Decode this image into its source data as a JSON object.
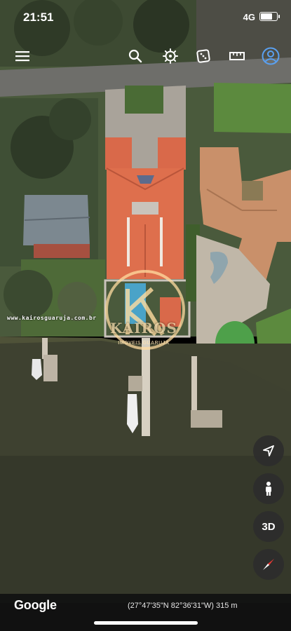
{
  "status_bar": {
    "time": "21:51",
    "network": "4G",
    "battery_level": 0.8
  },
  "toolbar": {
    "items": [
      {
        "icon": "menu-icon"
      },
      {
        "icon": "search-icon"
      },
      {
        "icon": "voyager-wheel-icon"
      },
      {
        "icon": "dice-icon"
      },
      {
        "icon": "ruler-icon"
      },
      {
        "icon": "account-icon"
      }
    ]
  },
  "watermark": {
    "url": "www.kairosguaruja.com.br",
    "brand": "KAIROS",
    "tagline": "IMOVEIS GUARUJA"
  },
  "map_controls": {
    "navigate_icon": "navigation-arrow-icon",
    "pegman_icon": "pegman-icon",
    "view_3d_label": "3D",
    "compass_icon": "compass-icon"
  },
  "footer": {
    "logo": "Google",
    "coordinates": "(27°47'35\"N 82°36'31\"W) 315 m"
  }
}
